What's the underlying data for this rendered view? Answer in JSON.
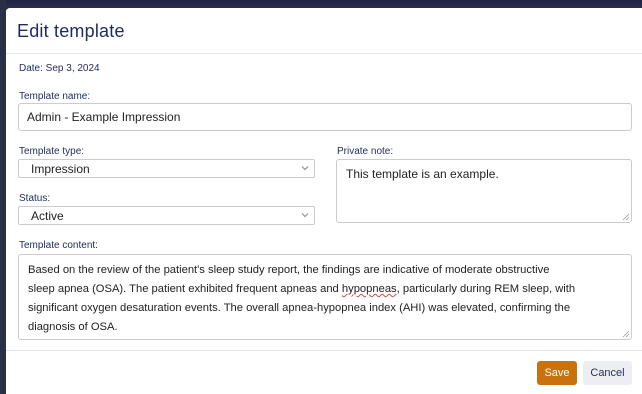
{
  "modal": {
    "title": "Edit template",
    "date_label": "Date: Sep 3, 2024"
  },
  "form": {
    "template_name": {
      "label": "Template name:",
      "value": "Admin - Example Impression"
    },
    "template_type": {
      "label": "Template type:",
      "value": "Impression"
    },
    "status": {
      "label": "Status:",
      "value": "Active"
    },
    "private_note": {
      "label": "Private note:",
      "value": "This template is an example."
    },
    "template_content": {
      "label": "Template content:",
      "line1": "Based on the review of the patient's sleep study report, the findings are indicative of moderate obstructive",
      "line2_a": "sleep apnea (OSA). The patient exhibited frequent apneas and ",
      "line2_b": "hypopneas",
      "line2_c": ", particularly during REM sleep, with",
      "line3": "significant oxygen desaturation events. The overall apnea-hypopnea index (AHI) was elevated, confirming the",
      "line4": "diagnosis of OSA."
    }
  },
  "footer": {
    "save_label": "Save",
    "cancel_label": "Cancel"
  },
  "colors": {
    "title": "#1f2a5e",
    "save_bg": "#c8710f",
    "cancel_bg": "#eceef2"
  }
}
